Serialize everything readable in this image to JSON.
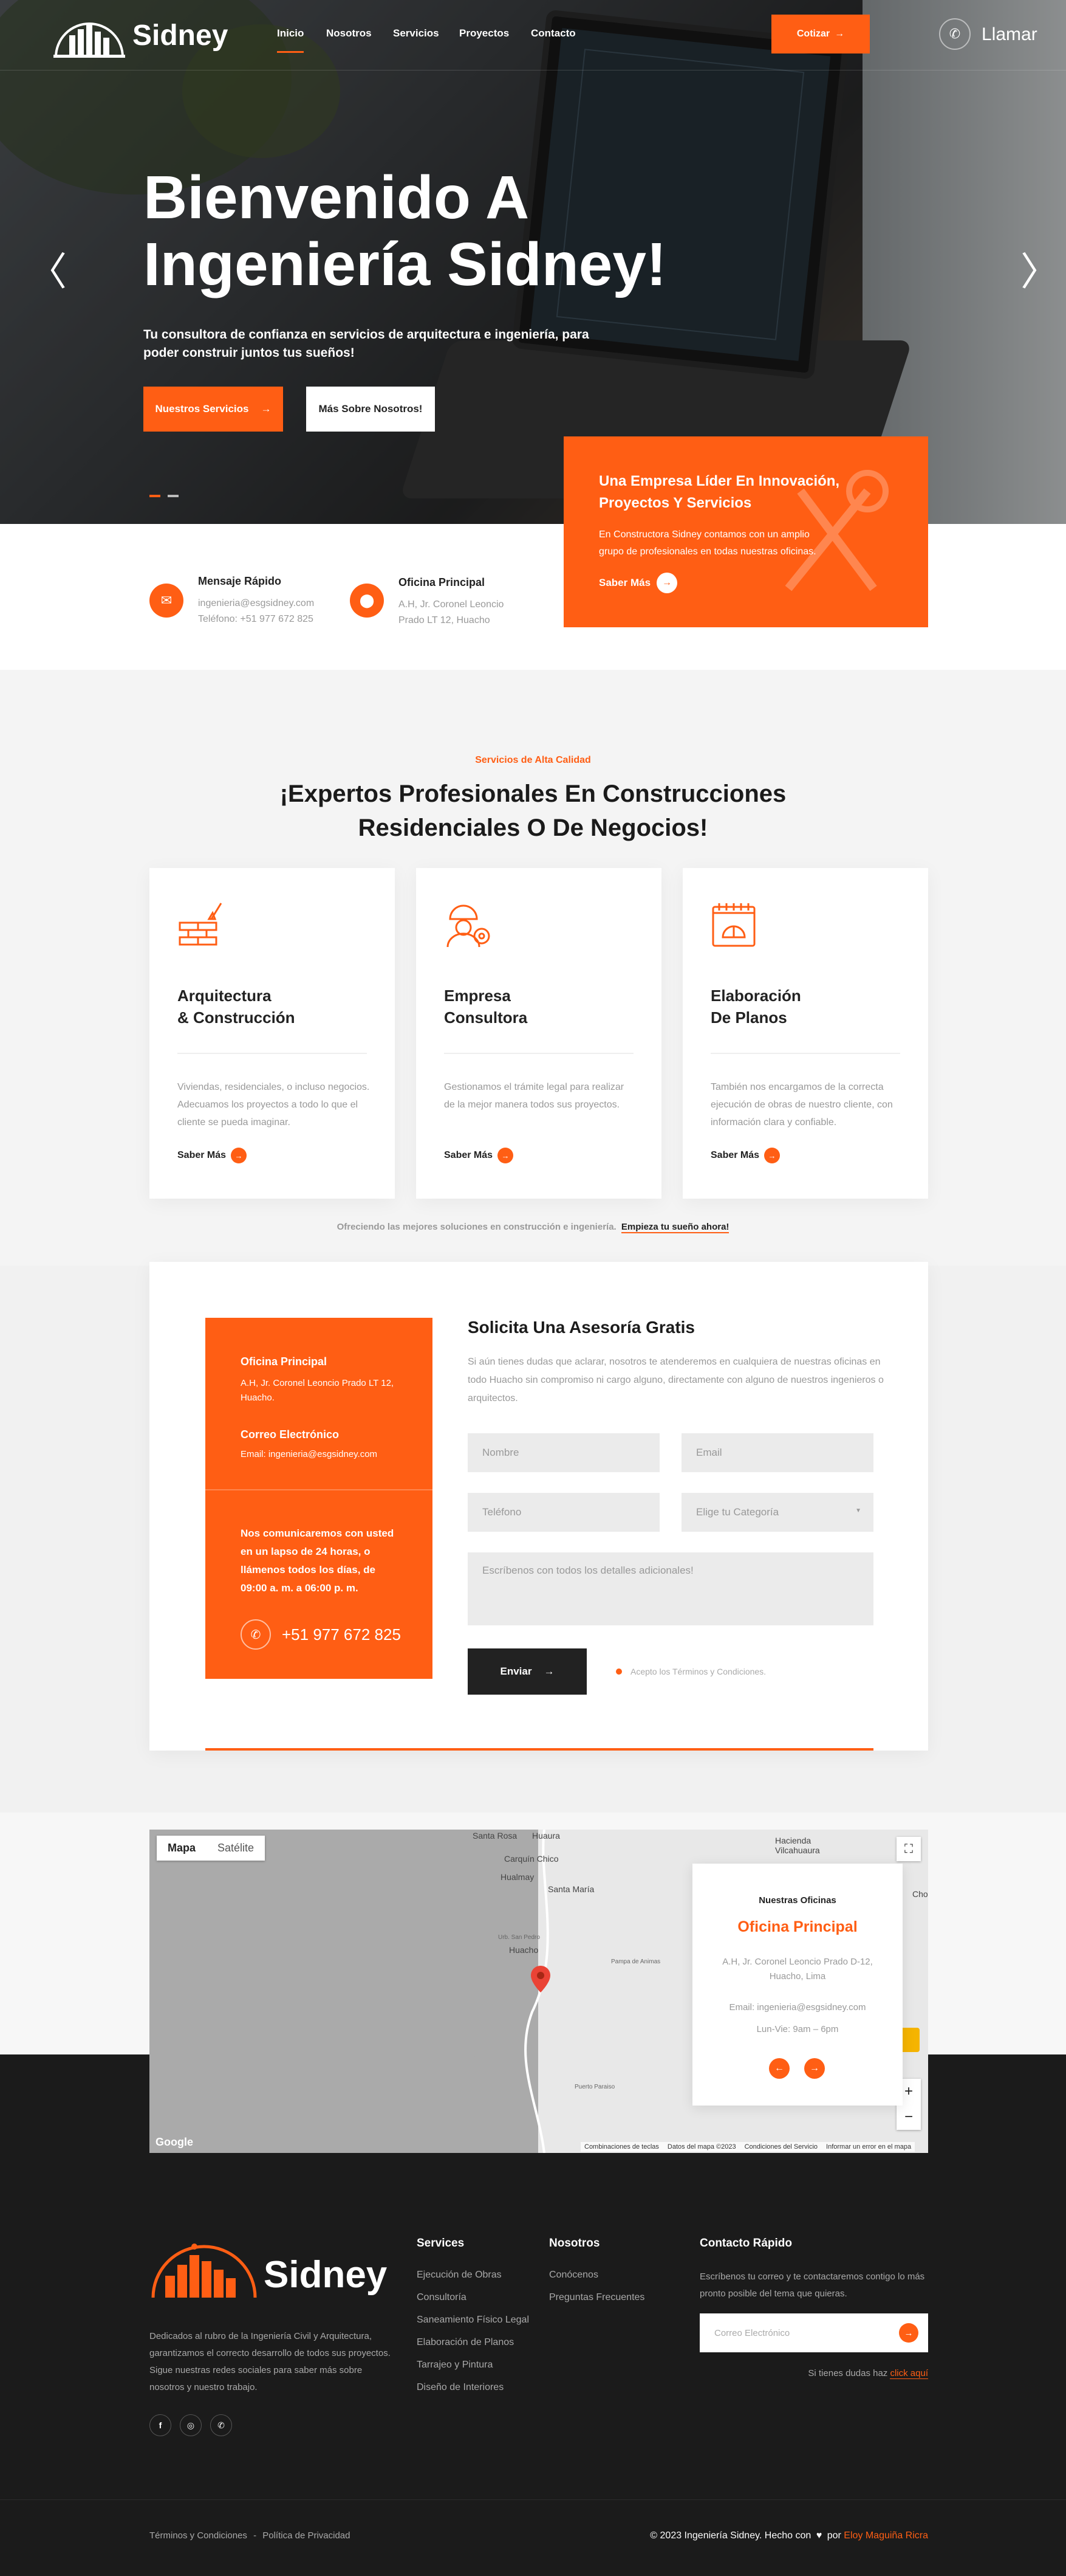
{
  "brand": {
    "name": "Sidney"
  },
  "nav": {
    "items": [
      {
        "label": "Inicio"
      },
      {
        "label": "Nosotros"
      },
      {
        "label": "Servicios"
      },
      {
        "label": "Proyectos"
      },
      {
        "label": "Contacto"
      }
    ],
    "quote_button": "Cotizar",
    "call_label": "Llamar"
  },
  "hero": {
    "title_line1": "Bienvenido A",
    "title_line2": "Ingeniería Sidney!",
    "subtitle": "Tu consultora de confianza en servicios de arquitectura e ingeniería, para poder construir juntos tus sueños!",
    "primary_button": "Nuestros Servicios",
    "secondary_button": "Más Sobre Nosotros!"
  },
  "promo": {
    "title": "Una Empresa Líder En Innovación, Proyectos Y Servicios",
    "text": "En Constructora Sidney contamos con un amplio grupo de profesionales en todas nuestras oficinas.",
    "link": "Saber Más"
  },
  "info": [
    {
      "title": "Mensaje Rápido",
      "line1": "ingenieria@esgsidney.com",
      "line2": "Teléfono: +51 977 672 825",
      "icon": "mail-icon"
    },
    {
      "title": "Oficina Principal",
      "line1": "A.H, Jr. Coronel Leoncio",
      "line2": "Prado LT 12, Huacho",
      "icon": "map-pin-icon"
    }
  ],
  "services": {
    "tagline": "Servicios de Alta Calidad",
    "heading_line1": "¡Expertos Profesionales En Construcciones",
    "heading_line2": "Residenciales O De Negocios!",
    "cards": [
      {
        "title1": "Arquitectura",
        "title2": "& Construcción",
        "text": "Viviendas, residenciales, o incluso negocios. Adecuamos los proyectos a todo lo que el cliente se pueda imaginar.",
        "link": "Saber Más",
        "icon": "brick-wall-icon"
      },
      {
        "title1": "Empresa",
        "title2": "Consultora",
        "text": "Gestionamos el trámite legal para realizar de la mejor manera todos sus proyectos.",
        "link": "Saber Más",
        "icon": "engineer-gear-icon"
      },
      {
        "title1": "Elaboración",
        "title2": "De Planos",
        "text": "También nos encargamos de la correcta ejecución de obras de nuestro cliente, con información clara y confiable.",
        "link": "Saber Más",
        "icon": "blueprint-icon"
      }
    ],
    "footer_text": "Ofreciendo las mejores soluciones en construcción e ingeniería.",
    "footer_link": "Empieza tu sueño ahora!"
  },
  "contact": {
    "office_title": "Oficina Principal",
    "office_text": "A.H, Jr. Coronel Leoncio Prado LT 12, Huacho.",
    "email_title": "Correo Electrónico",
    "email_text": "Email: ingenieria@esgsidney.com",
    "hours_text": "Nos comunicaremos con usted en un lapso de 24 horas, o llámenos todos los días, de 09:00 a. m. a 06:00 p. m.",
    "phone": "+51 977 672 825",
    "form_title": "Solicita Una Asesoría Gratis",
    "form_text": "Si aún tienes dudas que aclarar, nosotros te atenderemos en cualquiera de nuestras oficinas en todo Huacho sin compromiso ni cargo alguno, directamente con alguno de nuestros ingenieros o arquitectos.",
    "name_placeholder": "Nombre",
    "email_placeholder": "Email",
    "phone_placeholder": "Teléfono",
    "category_placeholder": "Elige tu Categoría",
    "message_placeholder": "Escríbenos con todos los detalles adicionales!",
    "submit": "Enviar",
    "terms": "Acepto los Términos y Condiciones."
  },
  "map": {
    "tab_map": "Mapa",
    "tab_satellite": "Satélite",
    "places": [
      "Santa Rosa",
      "Huaura",
      "Carquín Chico",
      "Hualmay",
      "Santa María",
      "Hacienda",
      "Vilcahuaura",
      "Huacho",
      "Urb. San Pedro",
      "Pampa de Animas",
      "Puerto Paraiso",
      "Cho"
    ],
    "card_small": "Nuestras Oficinas",
    "card_title": "Oficina Principal",
    "card_address": "A.H, Jr. Coronel Leoncio Prado D-12, Huacho, Lima",
    "card_email": "Email: ingenieria@esgsidney.com",
    "card_hours": "Lun-Vie: 9am – 6pm",
    "attrib": [
      "Combinaciones de teclas",
      "Datos del mapa ©2023",
      "Condiciones del Servicio",
      "Informar un error en el mapa"
    ],
    "google": "Google"
  },
  "footer": {
    "about": "Dedicados al rubro de la Ingeniería Civil y Arquitectura, garantizamos el correcto desarrollo de todos sus proyectos. Sigue nuestras redes sociales para saber más sobre nosotros y nuestro trabajo.",
    "services_title": "Services",
    "services": [
      "Ejecución de Obras",
      "Consultoría",
      "Saneamiento Físico Legal",
      "Elaboración de Planos",
      "Tarrajeo y Pintura",
      "Diseño de Interiores"
    ],
    "about_title": "Nosotros",
    "about_links": [
      "Conócenos",
      "Preguntas Frecuentes"
    ],
    "contact_title": "Contacto Rápido",
    "contact_text": "Escríbenos tu correo y te contactaremos contigo lo más pronto posible del tema que quieras.",
    "email_placeholder": "Correo Electrónico",
    "doubts_text": "Si tienes dudas haz",
    "doubts_link": "click aquí",
    "bottom_terms": "Términos y Condiciones",
    "bottom_privacy": "Política de Privacidad",
    "copyright": "© 2023 Ingeniería Sidney. Hecho con",
    "by": "por",
    "author": "Eloy Maguiña Ricra"
  },
  "colors": {
    "accent": "#ff5e14",
    "dark": "#1b1b1b"
  }
}
